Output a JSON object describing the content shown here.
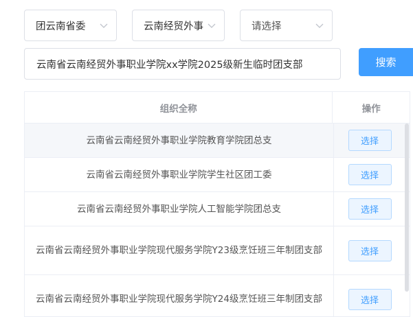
{
  "filters": {
    "province_committee": "团云南省委",
    "school": "云南经贸外事",
    "level3_placeholder": "请选择"
  },
  "search": {
    "value": "云南省云南经贸外事职业学院xx学院2025级新生临时团支部",
    "button_label": "搜索"
  },
  "table": {
    "headers": {
      "name": "组织全称",
      "action": "操作"
    },
    "rows": [
      {
        "name": "云南省云南经贸外事职业学院教育学院团总支",
        "action": "选择"
      },
      {
        "name": "云南省云南经贸外事职业学院学生社区团工委",
        "action": "选择"
      },
      {
        "name": "云南省云南经贸外事职业学院人工智能学院团总支",
        "action": "选择"
      },
      {
        "name": "云南省云南经贸外事职业学院现代服务学院Y23级烹饪班三年制团支部",
        "action": "选择"
      },
      {
        "name": "云南省云南经贸外事职业学院现代服务学院Y24级烹饪班三年制团支部",
        "action": "选择"
      }
    ]
  },
  "icons": {
    "dropdown": "chevron-down-icon"
  },
  "colors": {
    "primary": "#409eff",
    "border": "#dcdfe6",
    "row_highlight": "#f5f7fa",
    "header_text": "#909399"
  }
}
